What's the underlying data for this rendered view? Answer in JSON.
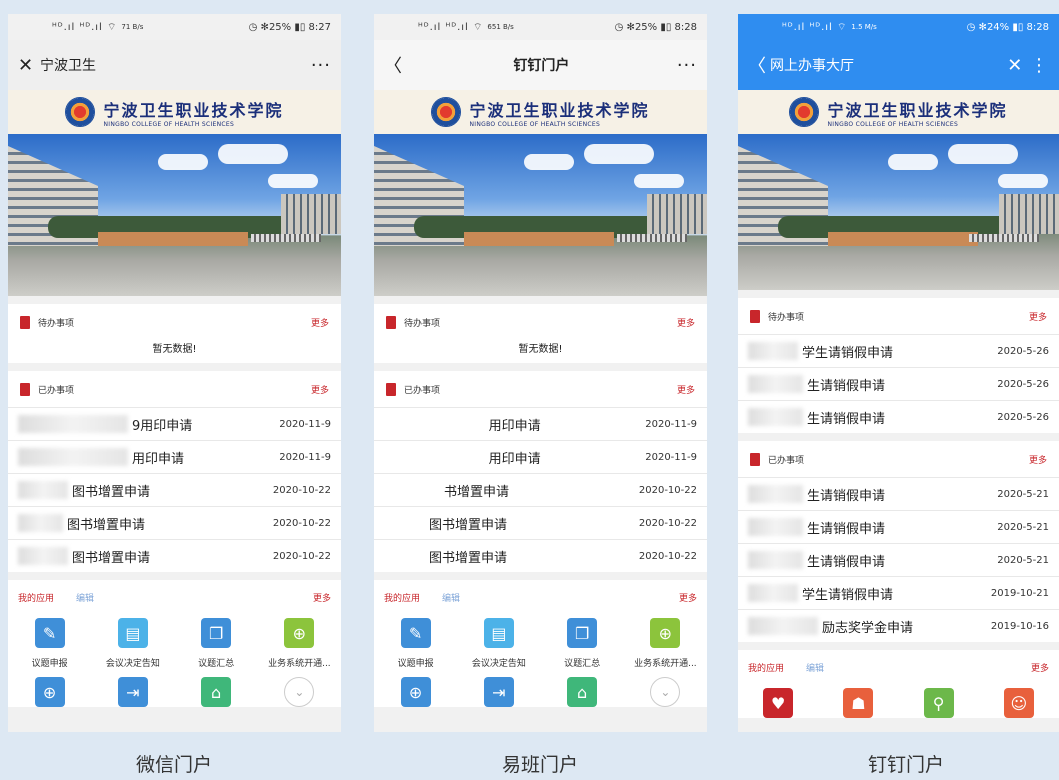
{
  "phones": [
    {
      "status": {
        "signal": "ᴴᴰ.ıl ᴴᴰ.ıl ⌔",
        "speed": "71 B/s",
        "right": "◷ ✻25% ▮▯ 8:27"
      },
      "header": {
        "left": "✕",
        "title": "宁波卫生",
        "right": "···"
      },
      "todo": {
        "title": "待办事项",
        "more": "更多",
        "empty": "暂无数据!"
      },
      "done": {
        "title": "已办事项",
        "more": "更多",
        "items": [
          {
            "name": "9用印申请",
            "date": "2020-11-9"
          },
          {
            "name": "用印申请",
            "date": "2020-11-9"
          },
          {
            "name": "图书增置申请",
            "date": "2020-10-22"
          },
          {
            "name": "图书增置申请",
            "date": "2020-10-22"
          },
          {
            "name": "图书增置申请",
            "date": "2020-10-22"
          }
        ]
      },
      "apps": {
        "title": "我的应用",
        "edit": "编辑",
        "more": "更多",
        "items": [
          "议题申报",
          "会议决定告知",
          "议题汇总",
          "业务系统开通..."
        ]
      }
    },
    {
      "status": {
        "signal": "ᴴᴰ.ıl ᴴᴰ.ıl ⌔",
        "speed": "651 B/s",
        "right": "◷ ✻25% ▮▯ 8:28"
      },
      "header": {
        "left": "〈",
        "title": "钉钉门户",
        "right": "···"
      },
      "todo": {
        "title": "待办事项",
        "more": "更多",
        "empty": "暂无数据!"
      },
      "done": {
        "title": "已办事项",
        "more": "更多",
        "items": [
          {
            "name": "用印申请",
            "date": "2020-11-9"
          },
          {
            "name": "用印申请",
            "date": "2020-11-9"
          },
          {
            "name": "书增置申请",
            "date": "2020-10-22"
          },
          {
            "name": "图书增置申请",
            "date": "2020-10-22"
          },
          {
            "name": "图书增置申请",
            "date": "2020-10-22"
          }
        ]
      },
      "apps": {
        "title": "我的应用",
        "edit": "编辑",
        "more": "更多",
        "items": [
          "议题申报",
          "会议决定告知",
          "议题汇总",
          "业务系统开通..."
        ]
      }
    },
    {
      "status": {
        "signal": "ᴴᴰ.ıl ᴴᴰ.ıl ⌔",
        "speed": "1.5 M/s",
        "right": "◷ ✻24% ▮▯ 8:28"
      },
      "header": {
        "left": "〈",
        "title": "网上办事大厅",
        "right": "✕  ⋮"
      },
      "todo": {
        "title": "待办事项",
        "more": "更多",
        "items": [
          {
            "name": "学生请销假申请",
            "date": "2020-5-26"
          },
          {
            "name": "生请销假申请",
            "date": "2020-5-26"
          },
          {
            "name": "生请销假申请",
            "date": "2020-5-26"
          }
        ]
      },
      "done": {
        "title": "已办事项",
        "more": "更多",
        "items": [
          {
            "name": "生请销假申请",
            "date": "2020-5-21"
          },
          {
            "name": "生请销假申请",
            "date": "2020-5-21"
          },
          {
            "name": "生请销假申请",
            "date": "2020-5-21"
          },
          {
            "name": "学生请销假申请",
            "date": "2019-10-21"
          },
          {
            "name": "励志奖学金申请",
            "date": "2019-10-16"
          }
        ]
      },
      "apps": {
        "title": "我的应用",
        "edit": "编辑",
        "more": "更多"
      }
    }
  ],
  "logo": {
    "cn": "宁波卫生职业技术学院",
    "en": "NINGBO COLLEGE OF HEALTH SCIENCES"
  },
  "captions": [
    "微信门户",
    "易班门户",
    "钉钉门户"
  ],
  "colors": {
    "accent": "#c8262b",
    "dingtalk_blue": "#2f8df0",
    "page_bg": "#dde8f3"
  }
}
